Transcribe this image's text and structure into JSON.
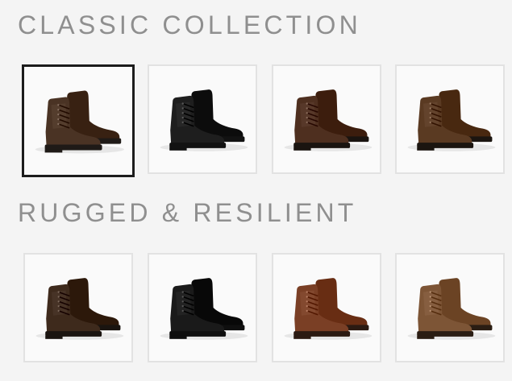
{
  "sections": [
    {
      "title": "CLASSIC COLLECTION",
      "swatches": [
        {
          "icon": "dark-brown-suede-boot-icon",
          "color": "#4a3324",
          "sole": "#1f1a17",
          "selected": true
        },
        {
          "icon": "black-leather-boot-icon",
          "color": "#1e1e1e",
          "sole": "#121212",
          "selected": false
        },
        {
          "icon": "brown-leather-boot-icon",
          "color": "#4e2f1f",
          "sole": "#1a1410",
          "selected": false
        },
        {
          "icon": "tobacco-leather-boot-icon",
          "color": "#5a3a22",
          "sole": "#1b1510",
          "selected": false
        }
      ]
    },
    {
      "title": "RUGGED & RESILIENT",
      "swatches": [
        {
          "icon": "dark-brown-rugged-boot-icon",
          "color": "#3e2a1c",
          "sole": "#1a1410",
          "selected": false
        },
        {
          "icon": "black-rugged-boot-icon",
          "color": "#1a1a1a",
          "sole": "#0f0f0f",
          "selected": false
        },
        {
          "icon": "chestnut-rugged-boot-icon",
          "color": "#7a3f25",
          "sole": "#2b1a12",
          "selected": false
        },
        {
          "icon": "tan-rugged-boot-icon",
          "color": "#7d5536",
          "sole": "#2a1d13",
          "selected": false
        }
      ]
    }
  ]
}
